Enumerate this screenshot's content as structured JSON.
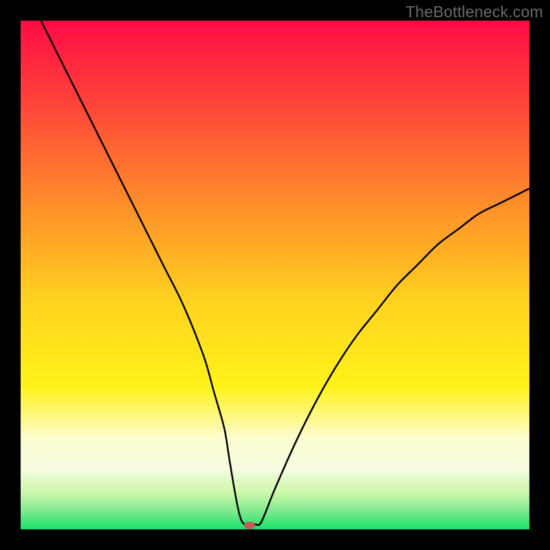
{
  "watermark": "TheBottleneck.com",
  "chart_data": {
    "type": "line",
    "title": "",
    "xlabel": "",
    "ylabel": "",
    "xlim": [
      0,
      100
    ],
    "ylim": [
      0,
      100
    ],
    "x": [
      4,
      8,
      12,
      16,
      20,
      24,
      28,
      32,
      36,
      38,
      40,
      41,
      42,
      43,
      44,
      46,
      47,
      48,
      50,
      54,
      58,
      62,
      66,
      70,
      74,
      78,
      82,
      86,
      90,
      94,
      98,
      100
    ],
    "y": [
      100,
      92,
      84,
      76,
      68,
      60,
      52,
      44,
      34,
      27,
      20,
      14,
      8,
      3,
      1,
      1,
      1,
      3,
      8,
      17,
      25,
      32,
      38,
      43,
      48,
      52,
      56,
      59,
      62,
      64,
      66,
      67
    ],
    "marker": {
      "x": 45,
      "y": 0.5
    },
    "gradient_stops": [
      {
        "offset": 0.0,
        "color": "#ff0b45"
      },
      {
        "offset": 0.15,
        "color": "#ff3f3a"
      },
      {
        "offset": 0.35,
        "color": "#ff8a2b"
      },
      {
        "offset": 0.55,
        "color": "#ffd21f"
      },
      {
        "offset": 0.72,
        "color": "#fff31a"
      },
      {
        "offset": 0.82,
        "color": "#fdfccf"
      },
      {
        "offset": 0.88,
        "color": "#f6fce0"
      },
      {
        "offset": 0.93,
        "color": "#c9f7a8"
      },
      {
        "offset": 0.965,
        "color": "#7de88e"
      },
      {
        "offset": 1.0,
        "color": "#17e36a"
      }
    ]
  }
}
